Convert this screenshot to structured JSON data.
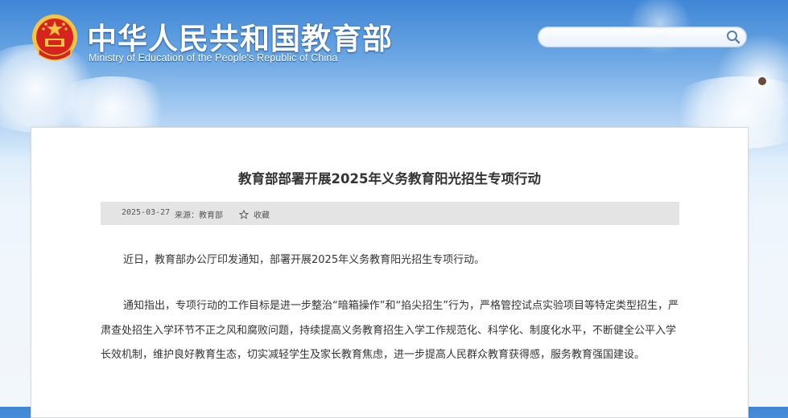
{
  "header": {
    "title": "中华人民共和国教育部",
    "subtitle": "Ministry of Education of the People's Republic of China",
    "emblem_icon": "national-emblem-icon"
  },
  "search": {
    "value": "",
    "placeholder": "",
    "button_icon": "search-icon"
  },
  "article": {
    "title": "教育部部署开展2025年义务教育阳光招生专项行动",
    "date": "2025-03-27",
    "source": "来源：教育部",
    "favorite_label": "收藏",
    "favorite_icon": "star-outline-icon",
    "paragraphs": [
      "近日，教育部办公厅印发通知，部署开展2025年义务教育阳光招生专项行动。",
      "通知指出，专项行动的工作目标是进一步整治“暗箱操作”和“掐尖招生”行为，严格管控试点实验项目等特定类型招生，严肃查处招生入学环节不正之风和腐败问题，持续提高义务教育招生入学工作规范化、科学化、制度化水平，不断健全公平入学长效机制，维护良好教育生态，切实减轻学生及家长教育焦虑，进一步提高人民群众教育获得感，服务教育强国建设。"
    ]
  },
  "colors": {
    "sky_top": "#3f86d6",
    "sky_bottom": "#eef5fc",
    "emblem_red": "#d7231e",
    "emblem_gold": "#f5c443",
    "meta_bar": "#e4e4e4",
    "text": "#333333"
  }
}
